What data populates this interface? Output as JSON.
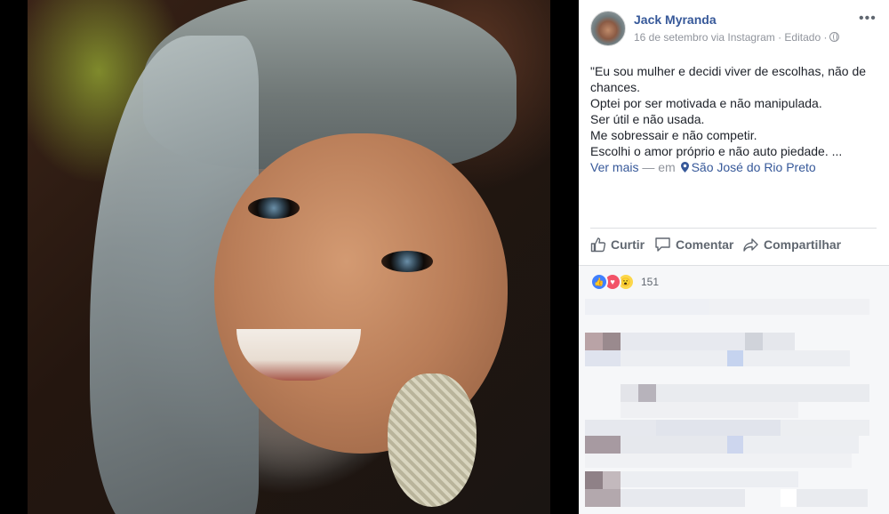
{
  "post": {
    "author": "Jack Myranda",
    "meta": "16 de setembro via Instagram · Editado ·",
    "more_label": "•••",
    "text_lines": [
      "\"Eu sou mulher e decidi viver de escolhas, não de",
      "chances.",
      "Optei por ser motivada e não manipulada.",
      "Ser útil e não usada.",
      "Me sobressair e não competir.",
      "Escolhi o amor próprio e não auto piedade. ..."
    ],
    "see_more": "Ver mais",
    "location_prefix": " — em",
    "location": "São José do Rio Preto"
  },
  "actions": {
    "like": "Curtir",
    "comment": "Comentar",
    "share": "Compartilhar"
  },
  "reactions": {
    "count": "151",
    "types": [
      "like-icon",
      "love-icon",
      "wow-icon"
    ]
  },
  "colors": {
    "link": "#365899",
    "muted": "#90949c",
    "text": "#1d2129",
    "comments_background": "#f6f7f9"
  }
}
